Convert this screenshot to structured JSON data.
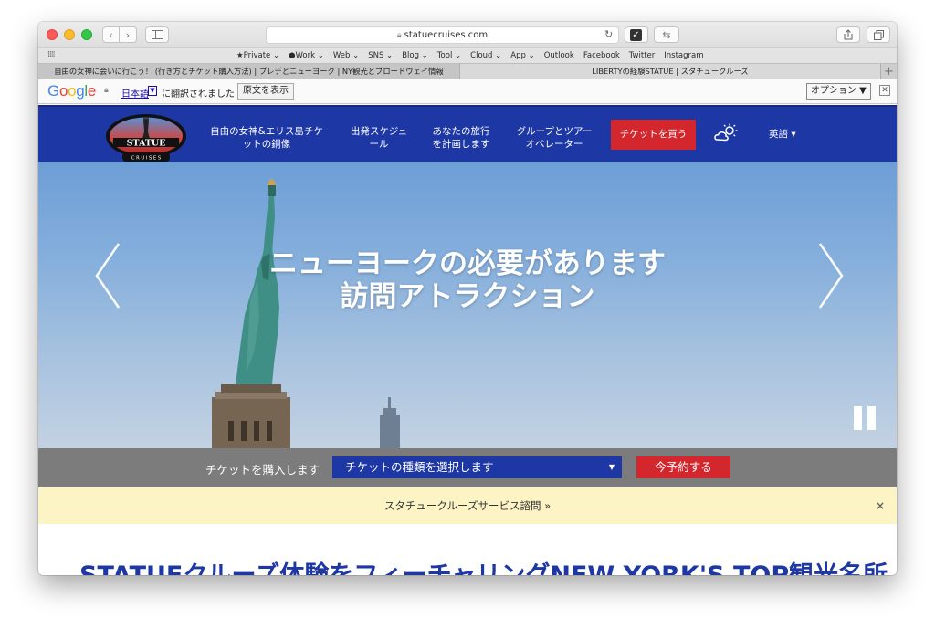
{
  "browser": {
    "url": "statuecruises.com",
    "bookmarks": [
      "★Private ⌄",
      "●Work ⌄",
      "Web ⌄",
      "SNS ⌄",
      "Blog ⌄",
      "Tool ⌄",
      "Cloud ⌄",
      "App ⌄",
      "Outlook",
      "Facebook",
      "Twitter",
      "Instagram"
    ],
    "tabs": [
      "自由の女神に会いに行こう！ (行き方とチケット購入方法) | プレデとニューヨーク | NY観光とブロードウェイ情報",
      "LIBERTYの経験STATUE | スタチュークルーズ"
    ]
  },
  "translate_bar": {
    "language": "日本語",
    "message": "に翻訳されました",
    "show_original": "原文を表示",
    "options": "オプション ▼"
  },
  "site_nav": {
    "logo_text": "STATUE",
    "logo_sub": "C R U I S E S",
    "links": [
      "自由の女神&エリス島チケットの銅像",
      "出発スケジュール",
      "あなたの旅行を計画します",
      "グループとツアーオペレーター"
    ],
    "link_lines": [
      [
        "自由の女神&エリス島チケ",
        "ットの銅像"
      ],
      [
        "出発スケジュ",
        "ール"
      ],
      [
        "あなたの旅行",
        "を計画します"
      ],
      [
        "グループとツアー",
        "オペレーター"
      ]
    ],
    "buy_tickets": "チケットを買う",
    "language": "英語 ▾"
  },
  "hero": {
    "title_line1": "ニューヨークの必要があります",
    "title_line2": "訪問アトラクション",
    "prev_arrow": "〈",
    "next_arrow": "〉"
  },
  "ticket_bar": {
    "label": "チケットを購入します",
    "select_value": "チケットの種類を選択します",
    "reserve_button": "今予約する"
  },
  "notice": {
    "text": "スタチュークルーズサービス諮問 »",
    "close": "×"
  },
  "content": {
    "heading": "STATUEクルーズ体験をフィーチャリングNEW YORK'S TOP観光名所"
  },
  "colors": {
    "nav_blue": "#1d37a5",
    "accent_red": "#d3262d",
    "notice_yellow": "#fdf4c6"
  }
}
